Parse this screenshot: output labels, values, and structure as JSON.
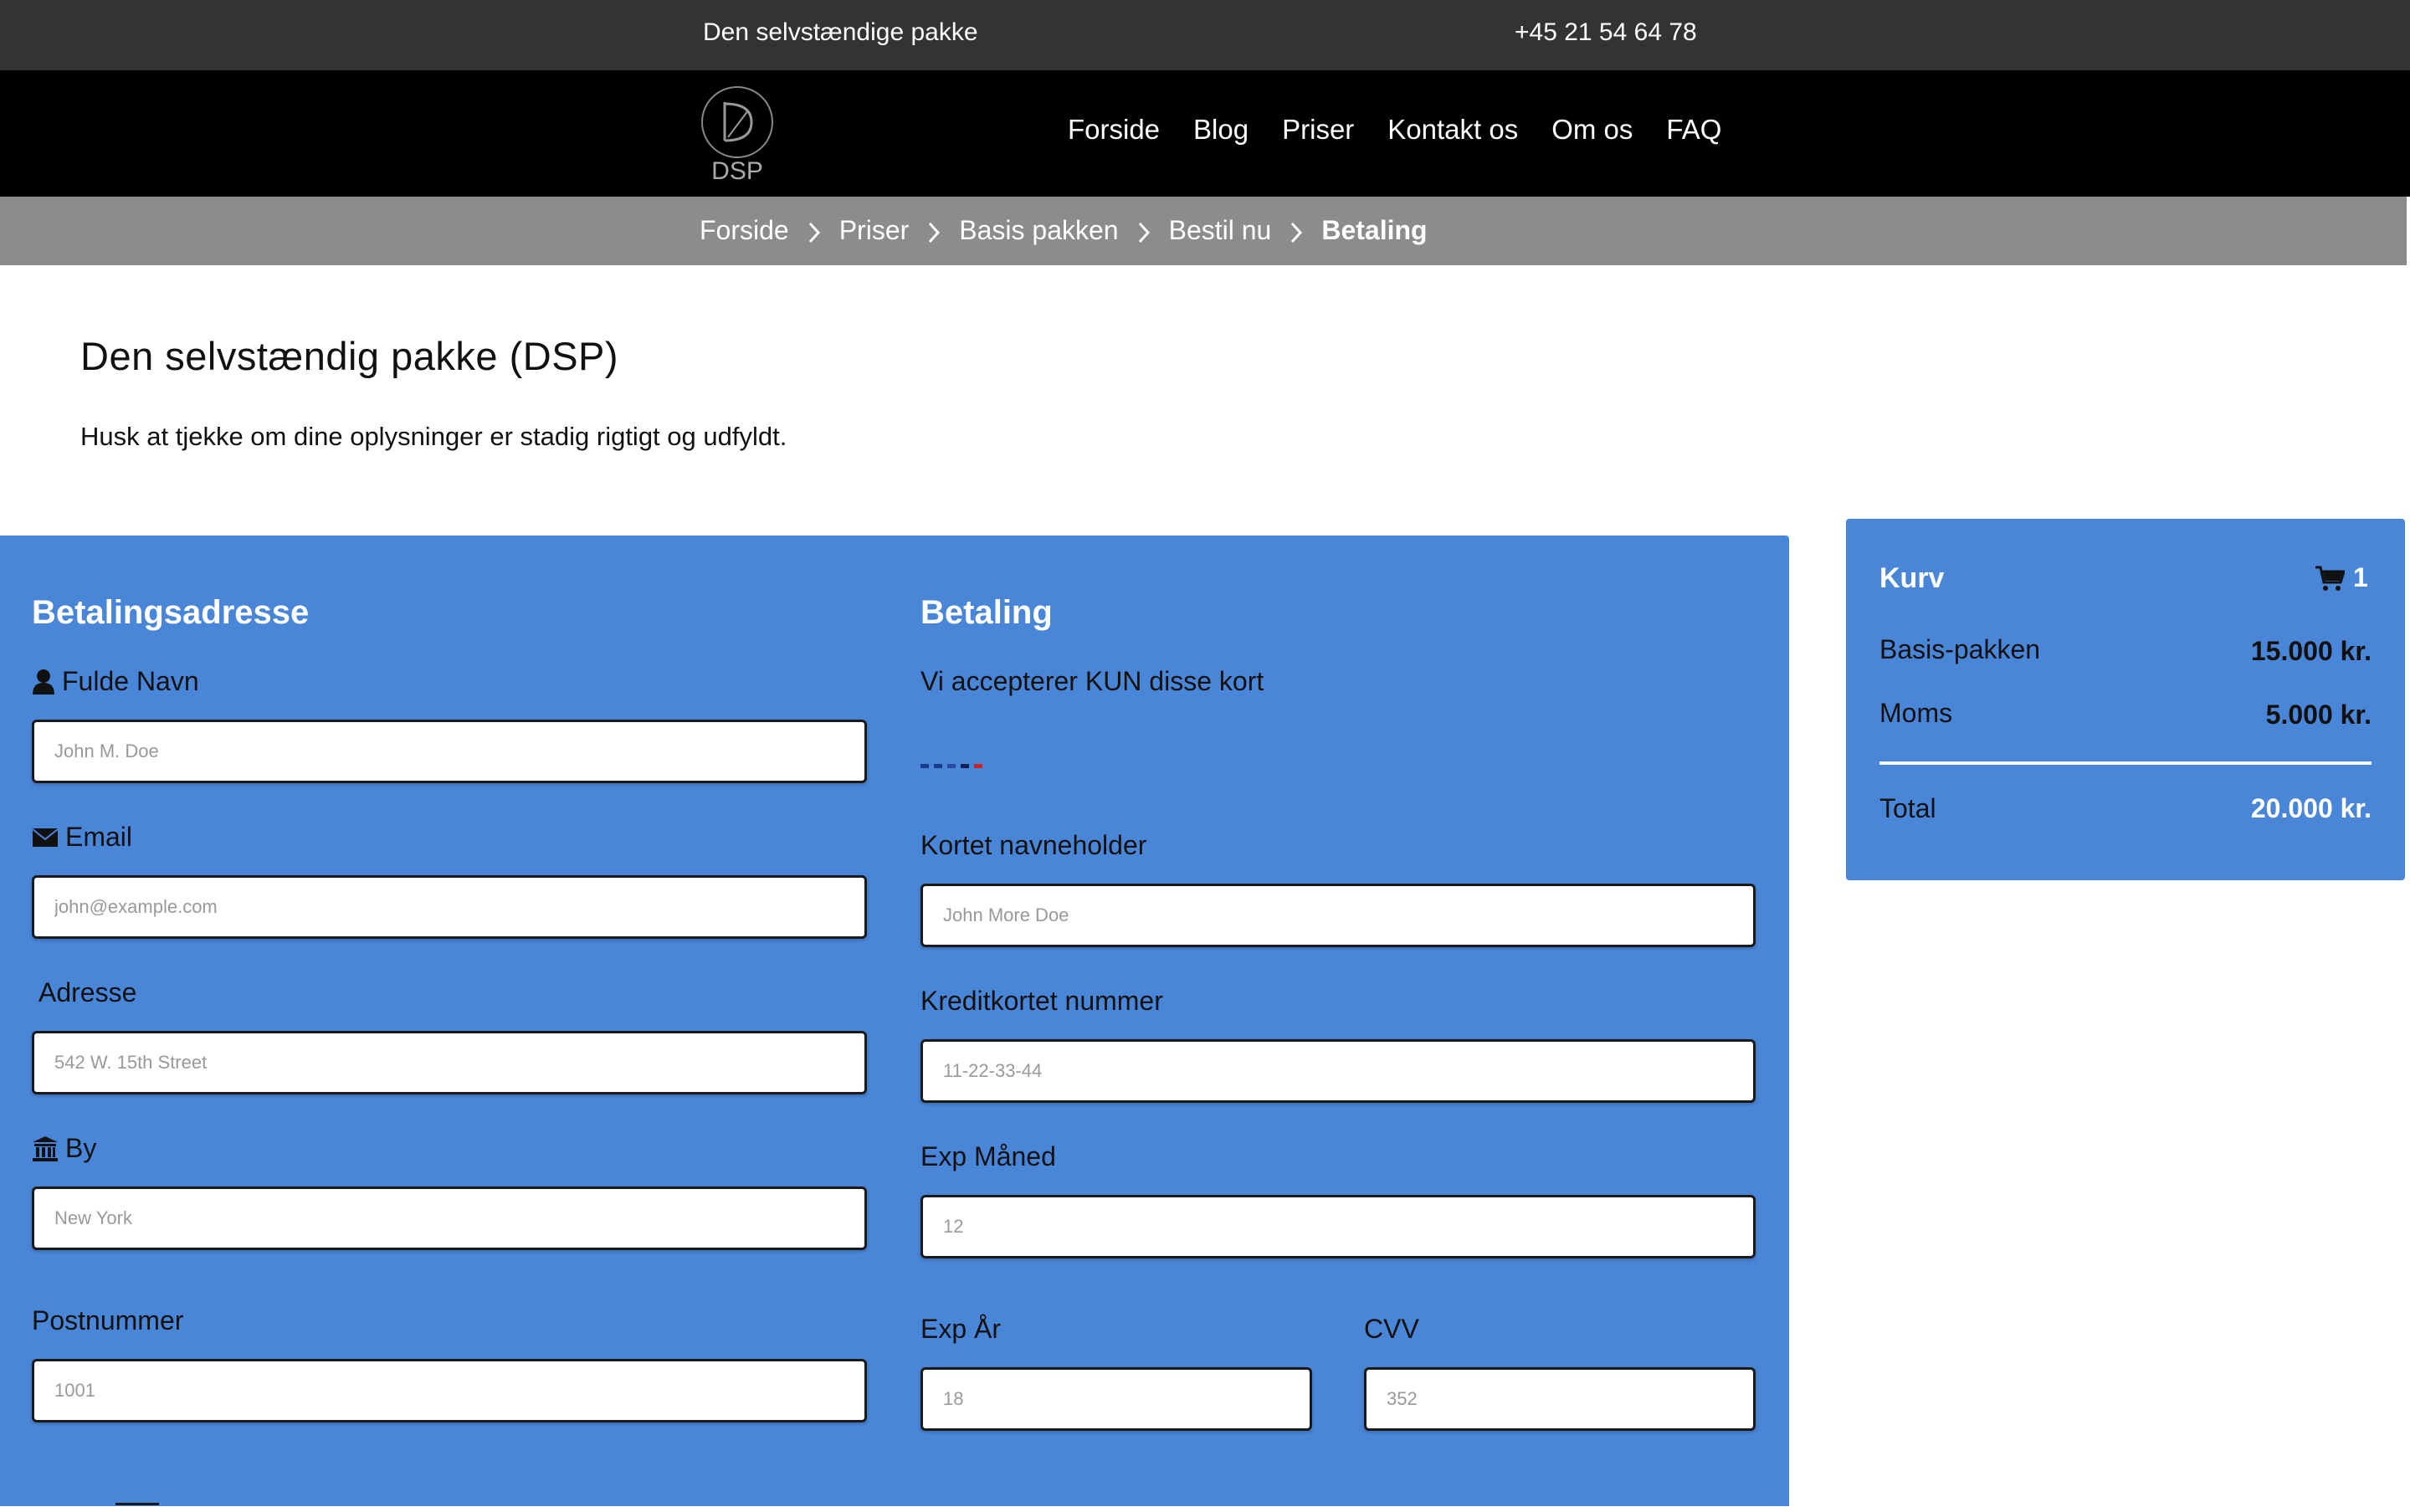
{
  "topbar": {
    "tagline": "Den selvstændige pakke",
    "phone": "+45 21 54 64 78"
  },
  "logo": {
    "text": "DSP"
  },
  "nav": {
    "items": [
      "Forside",
      "Blog",
      "Priser",
      "Kontakt os",
      "Om os",
      "FAQ"
    ]
  },
  "breadcrumb": {
    "items": [
      "Forside",
      "Priser",
      "Basis pakken",
      "Bestil nu",
      "Betaling"
    ]
  },
  "page": {
    "title": "Den selvstændig pakke (DSP)",
    "note": "Husk at tjekke om dine oplysninger er stadig rigtigt og udfyldt."
  },
  "billing": {
    "title": "Betalingsadresse",
    "name_label": "Fulde Navn",
    "name_placeholder": "John M. Doe",
    "email_label": "Email",
    "email_placeholder": "john@example.com",
    "address_label": "Adresse",
    "address_placeholder": "542 W. 15th Street",
    "city_label": "By",
    "city_placeholder": "New York",
    "zip_label": "Postnummer",
    "zip_placeholder": "1001"
  },
  "payment": {
    "title": "Betaling",
    "accepted_cards": "Vi accepterer KUN disse kort",
    "card_colors": [
      "#1a3a8a",
      "#1a3a8a",
      "#2a4aa0",
      "#102050",
      "#cc2222"
    ],
    "cardholder_label": "Kortet navneholder",
    "cardholder_placeholder": "John More Doe",
    "cardnum_label": "Kreditkortet nummer",
    "cardnum_placeholder": "11-22-33-44",
    "expmonth_label": "Exp Måned",
    "expmonth_placeholder": "12",
    "expyear_label": "Exp År",
    "expyear_placeholder": "18",
    "cvv_label": "CVV",
    "cvv_placeholder": "352"
  },
  "cart": {
    "title": "Kurv",
    "count": "1",
    "item_label": "Basis-pakken",
    "item_value": "15.000 kr.",
    "tax_label": "Moms",
    "tax_value": "5.000 kr.",
    "total_label": "Total",
    "total_value": "20.000 kr."
  },
  "colors": {
    "panel": "#4a86d8",
    "topbar": "#333333",
    "navbar": "#000000",
    "breadcrumb": "#8c8c8c"
  }
}
